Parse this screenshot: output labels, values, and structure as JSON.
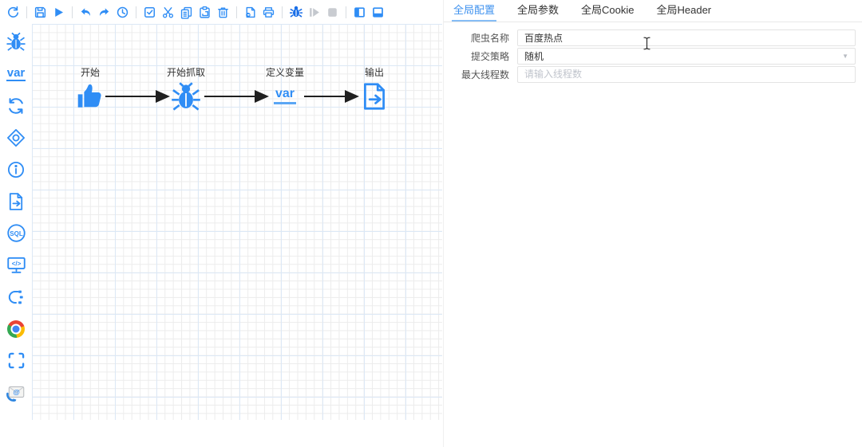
{
  "colors": {
    "accent": "#2f8df5",
    "debug_icon": "#1a6fe8",
    "disabled_icon": "#c4c8ce",
    "tab_active": "#3f92ef",
    "tab_underline": "#86bdf5",
    "grid_minor": "#ececec",
    "grid_major": "#dce8f6",
    "edge": "#1f1f1f",
    "placeholder": "#c0c4cc"
  },
  "toolbar": {
    "icons": [
      "reset",
      "save",
      "run",
      "undo",
      "redo",
      "history",
      "select-all",
      "cut",
      "copy",
      "paste",
      "delete",
      "export",
      "print",
      "debug",
      "step-resume",
      "stop",
      "toggle-left-panel",
      "toggle-bottom-panel"
    ]
  },
  "sidebar": {
    "items": [
      "spider-node",
      "variable-node",
      "loop-node",
      "condition-node",
      "comment-node",
      "output-node",
      "sql-node",
      "script-node",
      "function-node",
      "chrome-node",
      "selector-node",
      "email-node"
    ],
    "var_label": "var",
    "sql_label": "SQL",
    "code_label": "</>"
  },
  "canvas": {
    "nodes": [
      {
        "label": "开始",
        "icon": "thumb-up-icon"
      },
      {
        "label": "开始抓取",
        "icon": "spider-icon"
      },
      {
        "label": "定义变量",
        "icon": "var-text",
        "text": "var"
      },
      {
        "label": "输出",
        "icon": "output-icon"
      }
    ]
  },
  "right_panel": {
    "tabs": [
      {
        "label": "全局配置",
        "active": true
      },
      {
        "label": "全局参数",
        "active": false
      },
      {
        "label": "全局Cookie",
        "active": false
      },
      {
        "label": "全局Header",
        "active": false
      }
    ],
    "form": {
      "rows": [
        {
          "label": "爬虫名称",
          "value": "百度热点"
        },
        {
          "label": "提交策略",
          "value": "随机"
        },
        {
          "label": "最大线程数",
          "placeholder": "请输入线程数"
        }
      ]
    }
  }
}
